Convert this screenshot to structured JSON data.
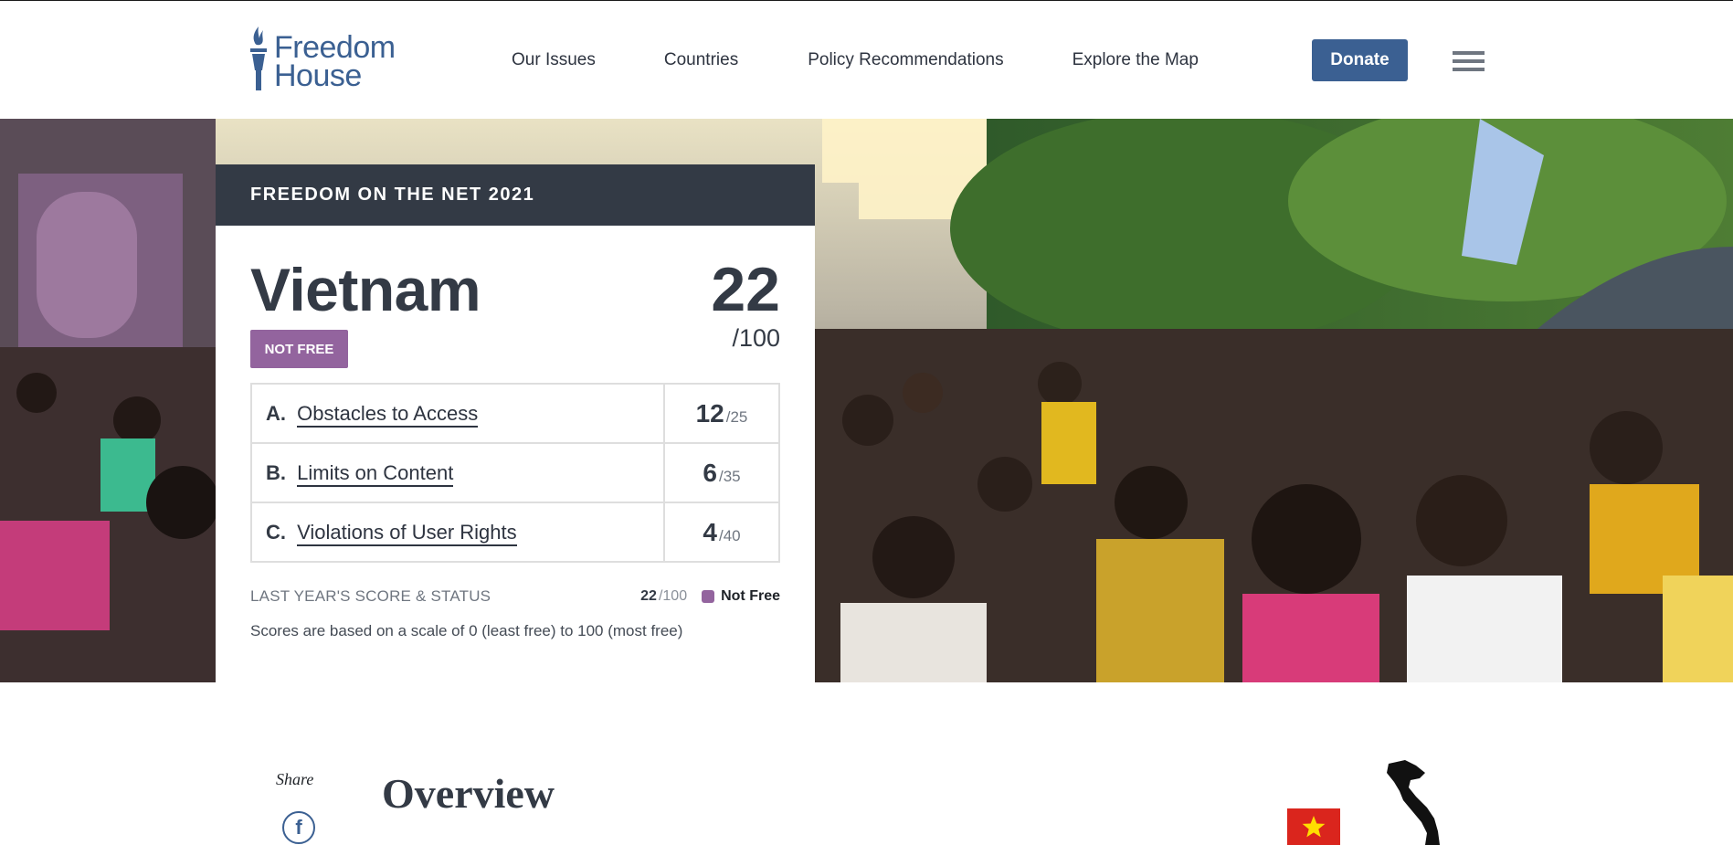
{
  "header": {
    "logo_line1": "Freedom",
    "logo_line2": "House",
    "nav": [
      "Our Issues",
      "Countries",
      "Policy Recommendations",
      "Explore the Map"
    ],
    "donate_label": "Donate"
  },
  "card": {
    "report_title": "FREEDOM ON THE NET 2021",
    "country": "Vietnam",
    "total_score": "22",
    "total_max": "/100",
    "status": "NOT FREE",
    "categories": [
      {
        "letter": "A.",
        "label": "Obstacles to Access",
        "score": "12",
        "max": "/25"
      },
      {
        "letter": "B.",
        "label": "Limits on Content",
        "score": "6",
        "max": "/35"
      },
      {
        "letter": "C.",
        "label": "Violations of User Rights",
        "score": "4",
        "max": "/40"
      }
    ],
    "last_year_label": "LAST YEAR'S SCORE & STATUS",
    "last_year_score": "22",
    "last_year_max": "/100",
    "last_year_status": "Not Free",
    "scale_note": "Scores are based on a scale of 0 (least free) to 100 (most free)"
  },
  "content": {
    "share_label": "Share",
    "overview_title": "Overview"
  },
  "colors": {
    "brand_blue": "#3b6092",
    "dark": "#333a45",
    "not_free_purple": "#93649e"
  }
}
